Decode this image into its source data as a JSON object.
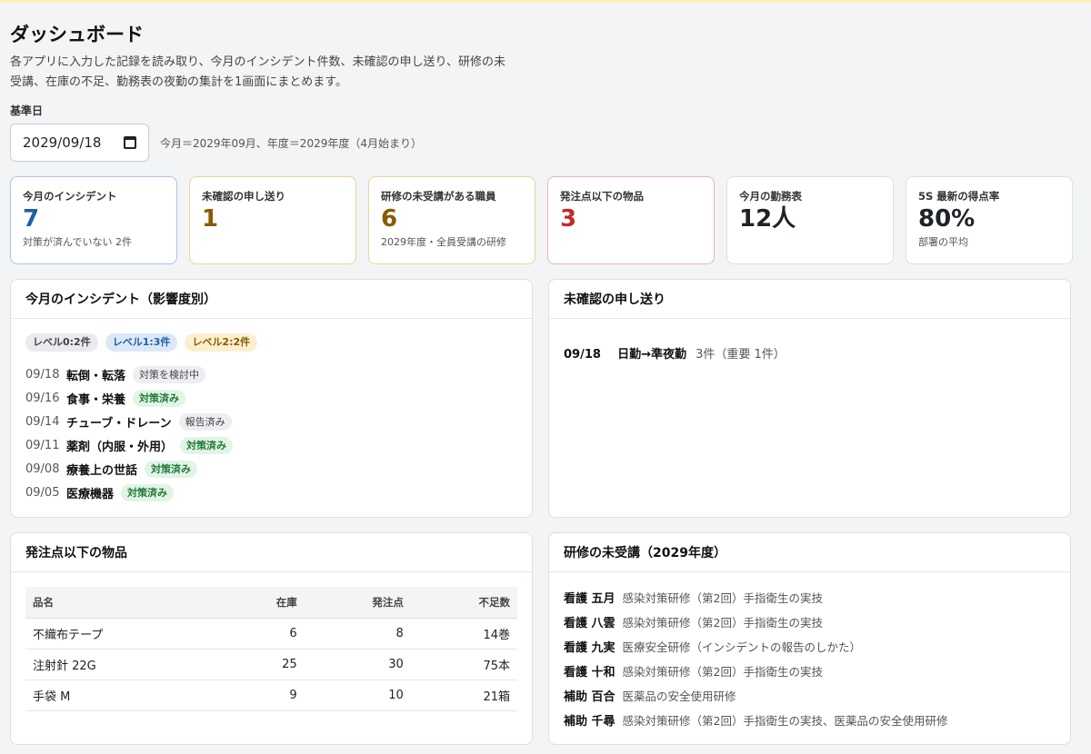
{
  "header": {
    "title": "ダッシュボード",
    "description": "各アプリに入力した記録を読み取り、今月のインシデント件数、未確認の申し送り、研修の未受講、在庫の不足、勤務表の夜勤の集計を1画面にまとめます。"
  },
  "filter": {
    "label": "基準日",
    "date_value": "2029/09/18",
    "note": "今月＝2029年09月、年度＝2029年度（4月始まり）"
  },
  "kpis": [
    {
      "label": "今月のインシデント",
      "value": "7",
      "sub": "対策が済んでいない 2件"
    },
    {
      "label": "未確認の申し送り",
      "value": "1",
      "sub": ""
    },
    {
      "label": "研修の未受講がある職員",
      "value": "6",
      "sub": "2029年度・全員受講の研修"
    },
    {
      "label": "発注点以下の物品",
      "value": "3",
      "sub": ""
    },
    {
      "label": "今月の勤務表",
      "value": "12人",
      "sub": ""
    },
    {
      "label": "5S 最新の得点率",
      "value": "80%",
      "sub": "部署の平均"
    }
  ],
  "incidents": {
    "title": "今月のインシデント（影響度別）",
    "levels": [
      "レベル0:2件",
      "レベル1:3件",
      "レベル2:2件"
    ],
    "rows": [
      {
        "date": "09/18",
        "category": "転倒・転落",
        "status": "対策を検討中"
      },
      {
        "date": "09/16",
        "category": "食事・栄養",
        "status": "対策済み"
      },
      {
        "date": "09/14",
        "category": "チューブ・ドレーン",
        "status": "報告済み"
      },
      {
        "date": "09/11",
        "category": "薬剤（内服・外用）",
        "status": "対策済み"
      },
      {
        "date": "09/08",
        "category": "療養上の世話",
        "status": "対策済み"
      },
      {
        "date": "09/05",
        "category": "医療機器",
        "status": "対策済み"
      }
    ]
  },
  "handover": {
    "title": "未確認の申し送り",
    "rows": [
      {
        "date": "09/18",
        "shift": "日勤→準夜勤",
        "note": "3件（重要 1件）"
      }
    ]
  },
  "stock": {
    "title": "発注点以下の物品",
    "columns": [
      "品名",
      "在庫",
      "発注点",
      "不足数"
    ],
    "rows": [
      [
        "不織布テープ",
        "6",
        "8",
        "14巻"
      ],
      [
        "注射針 22G",
        "25",
        "30",
        "75本"
      ],
      [
        "手袋 M",
        "9",
        "10",
        "21箱"
      ]
    ]
  },
  "training": {
    "title": "研修の未受講（2029年度）",
    "rows": [
      {
        "name": "看護 五月",
        "courses": "感染対策研修（第2回）手指衛生の実技"
      },
      {
        "name": "看護 八雲",
        "courses": "感染対策研修（第2回）手指衛生の実技"
      },
      {
        "name": "看護 九実",
        "courses": "医療安全研修（インシデントの報告のしかた）"
      },
      {
        "name": "看護 十和",
        "courses": "感染対策研修（第2回）手指衛生の実技"
      },
      {
        "name": "補助 百合",
        "courses": "医薬品の安全使用研修"
      },
      {
        "name": "補助 千尋",
        "courses": "感染対策研修（第2回）手指衛生の実技、医薬品の安全使用研修"
      }
    ]
  }
}
